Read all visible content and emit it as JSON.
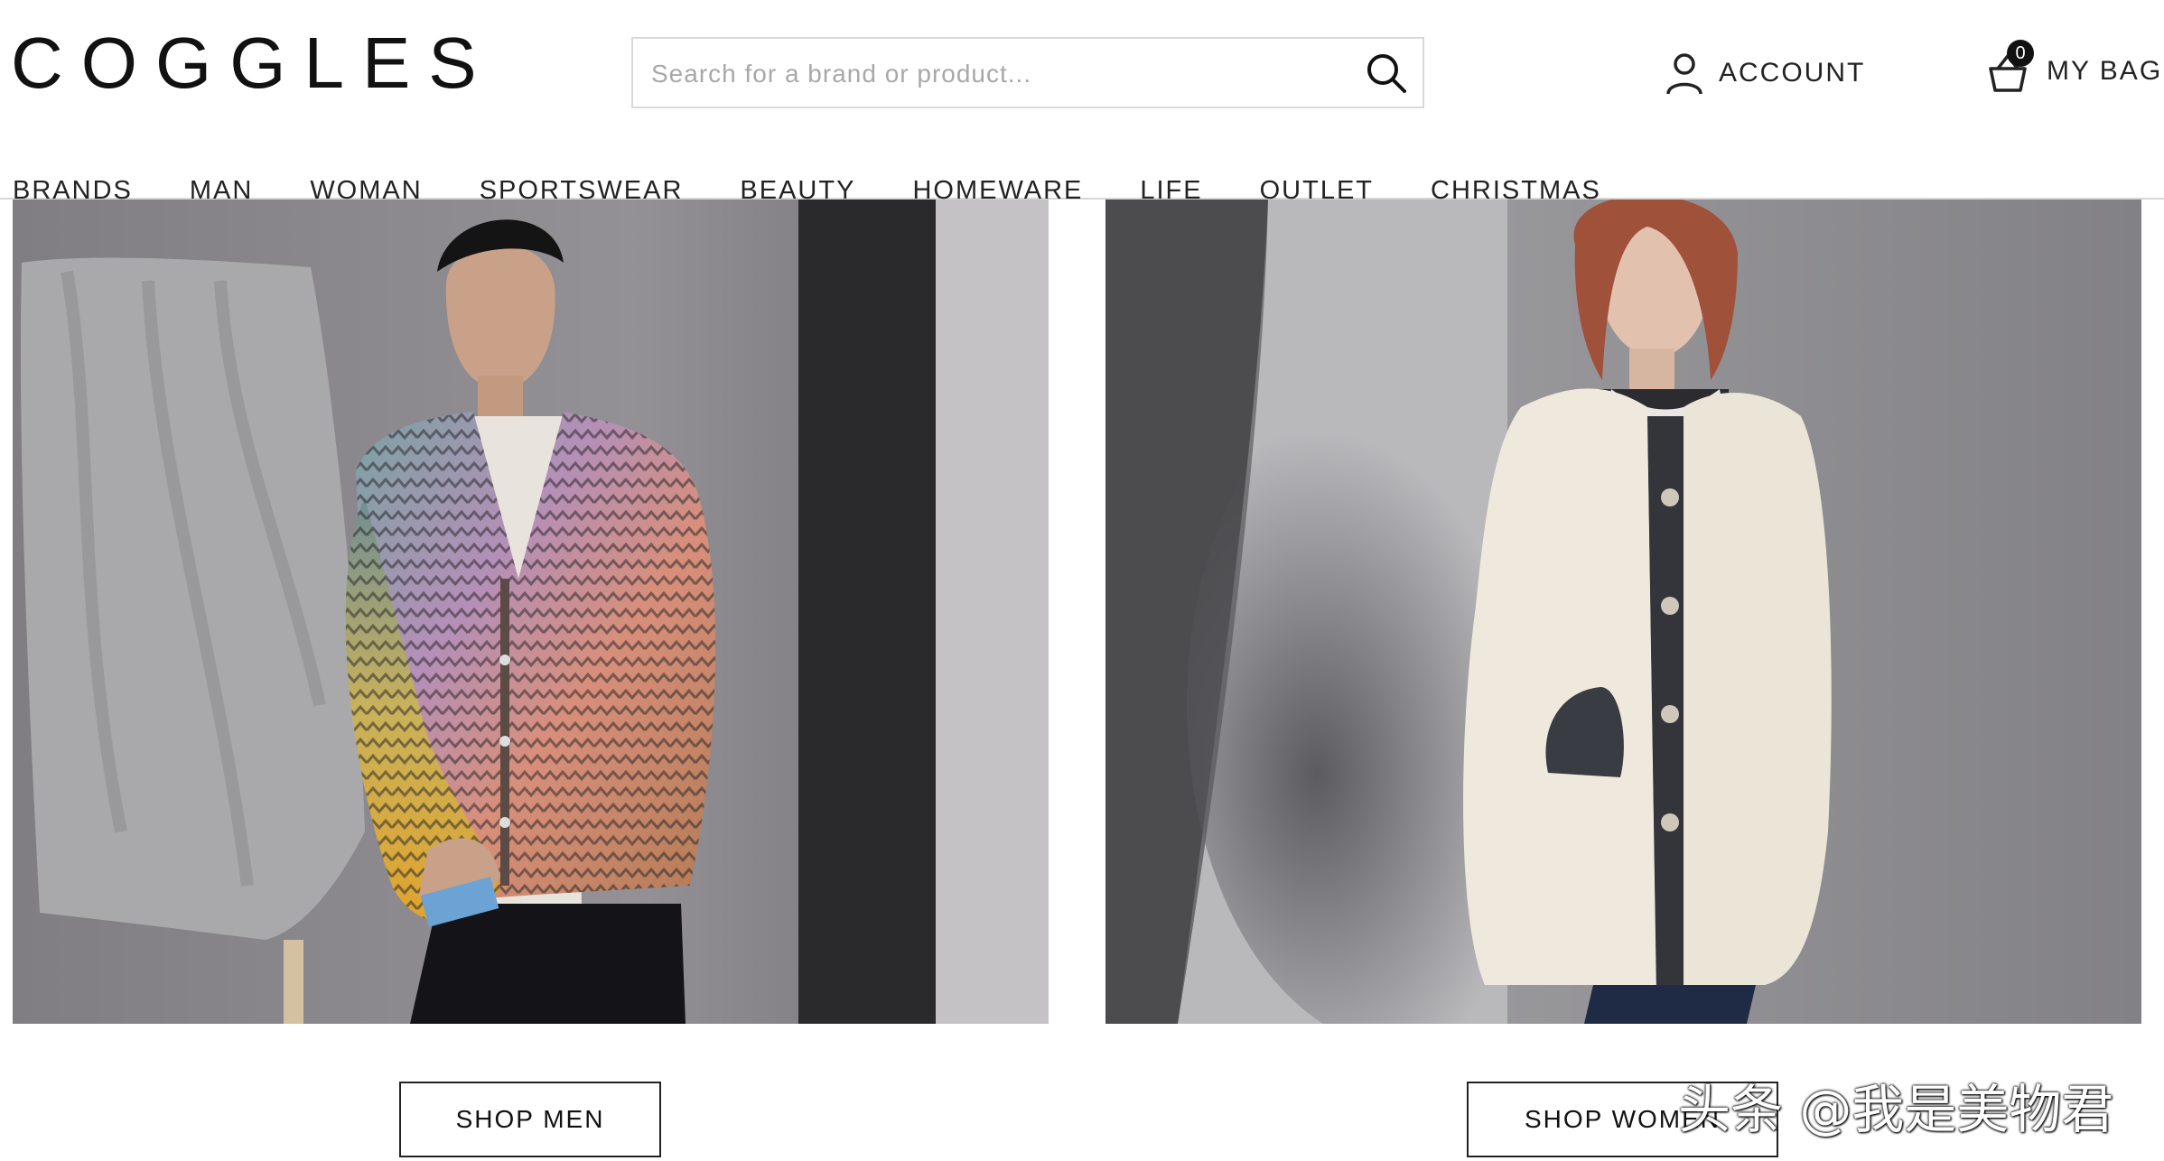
{
  "header": {
    "logo": "COGGLES",
    "search": {
      "placeholder": "Search for a brand or product..."
    },
    "account_label": "ACCOUNT",
    "bag_label": "MY BAG",
    "bag_count": "0"
  },
  "nav": {
    "items": [
      "BRANDS",
      "MAN",
      "WOMAN",
      "SPORTSWEAR",
      "BEAUTY",
      "HOMEWARE",
      "LIFE",
      "OUTLET",
      "CHRISTMAS"
    ]
  },
  "hero": {
    "men_cta": "SHOP MEN",
    "women_cta": "SHOP WOMEN"
  },
  "watermark": "头条 @我是美物君",
  "colors": {
    "text": "#1c1c1c",
    "border": "#d9d9d9",
    "cta_border": "#222222"
  }
}
